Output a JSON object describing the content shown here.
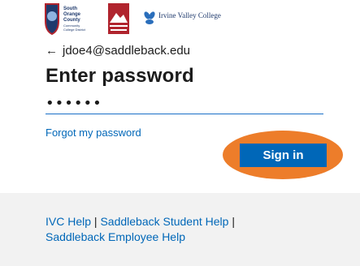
{
  "header": {
    "logo_socccd_lines": [
      "South",
      "Orange",
      "County",
      "Community",
      "College District"
    ],
    "logo_ivc": "Irvine Valley College"
  },
  "identity": {
    "back_icon": "left-arrow-icon",
    "email": "jdoe4@saddleback.edu"
  },
  "form": {
    "title": "Enter password",
    "password_value": "••••••",
    "forgot_label": "Forgot my password",
    "signin_label": "Sign in"
  },
  "footer": {
    "help_ivc": "IVC Help",
    "sep1": " | ",
    "help_student": "Saddleback Student Help",
    "sep2": " | ",
    "help_employee": "Saddleback Employee Help"
  },
  "colors": {
    "accent": "#0067b8",
    "highlight": "#ed7d2a",
    "footer_bg": "#f2f2f2"
  }
}
